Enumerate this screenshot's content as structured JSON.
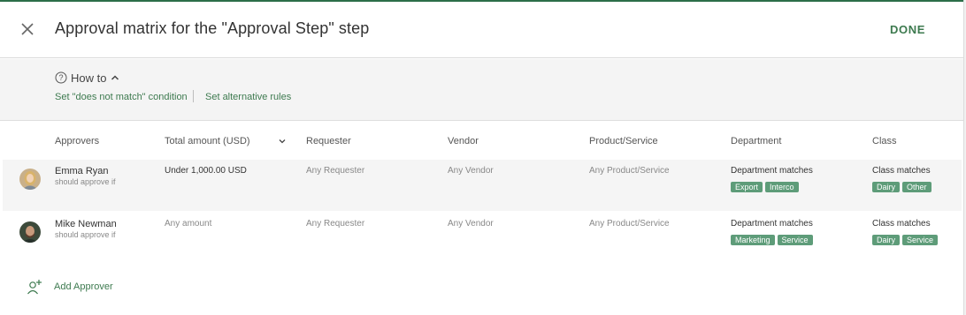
{
  "header": {
    "title": "Approval matrix for the \"Approval Step\" step",
    "done_label": "DONE",
    "close_icon": "close-icon"
  },
  "howto": {
    "label": "How to",
    "link1": "Set \"does not match\" condition",
    "link2": "Set alternative rules"
  },
  "columns": {
    "approvers": "Approvers",
    "total": "Total amount (USD)",
    "requester": "Requester",
    "vendor": "Vendor",
    "product": "Product/Service",
    "department": "Department",
    "class": "Class"
  },
  "rows": [
    {
      "name": "Emma Ryan",
      "sub": "should approve if",
      "total": "Under 1,000.00 USD",
      "requester": "Any Requester",
      "vendor": "Any Vendor",
      "product": "Any Product/Service",
      "department": {
        "condition": "Department matches",
        "tags": [
          "Export",
          "Interco"
        ]
      },
      "class": {
        "condition": "Class matches",
        "tags": [
          "Dairy",
          "Other"
        ]
      }
    },
    {
      "name": "Mike Newman",
      "sub": "should approve if",
      "total": "Any amount",
      "requester": "Any Requester",
      "vendor": "Any Vendor",
      "product": "Any Product/Service",
      "department": {
        "condition": "Department matches",
        "tags": [
          "Marketing",
          "Service"
        ]
      },
      "class": {
        "condition": "Class matches",
        "tags": [
          "Dairy",
          "Service"
        ]
      }
    }
  ],
  "add_approver": {
    "label": "Add Approver"
  },
  "colors": {
    "accent": "#3d7a4f",
    "tag": "#5e9c79",
    "band": "#f4f4f4"
  }
}
